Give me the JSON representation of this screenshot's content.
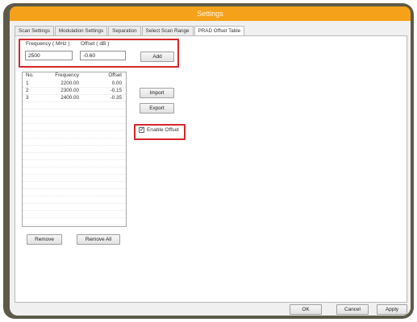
{
  "window": {
    "title": "Settings"
  },
  "tabs": [
    {
      "label": "Scan Settings"
    },
    {
      "label": "Modulation Settings"
    },
    {
      "label": "Separation"
    },
    {
      "label": "Select Scan Range"
    },
    {
      "label": "PRAD Offset Table"
    }
  ],
  "inputs": {
    "frequency_label": "Frequency ( MHz )",
    "frequency_value": "2500",
    "offset_label": "Offset ( dB )",
    "offset_value": "-0.60",
    "add_label": "Add"
  },
  "table": {
    "headers": [
      "No.",
      "Frequency",
      "Offset"
    ],
    "rows": [
      [
        "1",
        "2200.00",
        "0.00"
      ],
      [
        "2",
        "2300.00",
        "-0.15"
      ],
      [
        "3",
        "2400.00",
        "-0.35"
      ]
    ]
  },
  "buttons": {
    "import": "Import",
    "export": "Export",
    "remove": "Remove",
    "remove_all": "Remove All",
    "ok": "OK",
    "cancel": "Cancel",
    "apply": "Apply"
  },
  "enable_offset": {
    "label": "Enable Offset",
    "checked": true
  }
}
